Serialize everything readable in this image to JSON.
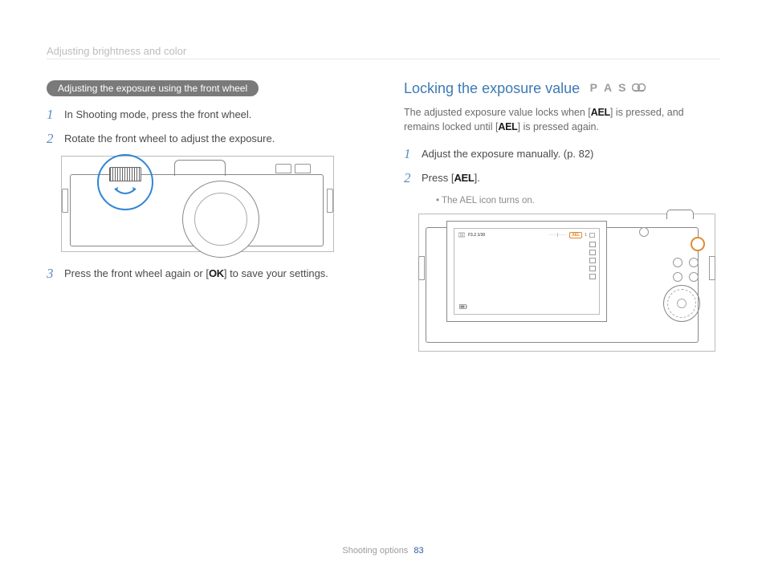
{
  "header": {
    "running_head": "Adjusting brightness and color"
  },
  "left": {
    "pill": "Adjusting the exposure using the front wheel",
    "steps": {
      "s1": {
        "num": "1",
        "text": "In Shooting mode, press the front wheel."
      },
      "s2": {
        "num": "2",
        "text": "Rotate the front wheel to adjust the exposure."
      },
      "s3": {
        "num": "3",
        "prefix": "Press the front wheel again or [",
        "ok": "OK",
        "suffix": "] to save your settings."
      }
    }
  },
  "right": {
    "title": "Locking the exposure value",
    "modes": [
      "P",
      "A",
      "S"
    ],
    "mode_movie_name": "movie-mode-icon",
    "lead": {
      "p1a": "The adjusted exposure value locks when [",
      "ael1": "AEL",
      "p1b": "] is pressed, and remains locked until [",
      "ael2": "AEL",
      "p1c": "] is pressed again."
    },
    "steps": {
      "s1": {
        "num": "1",
        "text": "Adjust the exposure manually. (p. 82)"
      },
      "s2": {
        "num": "2",
        "prefix": "Press [",
        "ael": "AEL",
        "suffix": "]."
      }
    },
    "bullet": "The AEL icon turns on.",
    "screen": {
      "readout": "F3.2 1/30",
      "ael_badge": "AEL",
      "count": "1"
    }
  },
  "footer": {
    "label": "Shooting options",
    "page": "83"
  }
}
